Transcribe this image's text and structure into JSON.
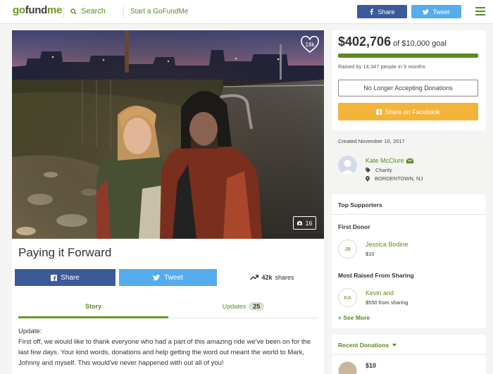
{
  "header": {
    "logo": {
      "part1": "go",
      "part2": "fund",
      "part3": "me"
    },
    "search_label": "Search",
    "start_label": "Start a GoFundMe",
    "share_label": "Share",
    "tweet_label": "Tweet"
  },
  "campaign": {
    "like_count": "18k",
    "photo_count": "16",
    "title": "Paying it Forward",
    "share_label": "Share",
    "tweet_label": "Tweet",
    "shares_count": "42k",
    "shares_suffix": "shares",
    "tabs": [
      {
        "label": "Story"
      },
      {
        "label": "Updates",
        "badge": "25"
      }
    ],
    "story": {
      "heading": "Update:",
      "body": "First off, we would like to thank everyone who had a part of this amazing ride we've been on for the last few days. Your kind words, donations and help getting the word out meant the world to Mark, Johnny and myself. This would've never happened with out all of you!"
    }
  },
  "donation": {
    "raised": "$402,706",
    "goal_text": "of $10,000 goal",
    "progress_fraction": 1.0,
    "raised_by": "Raised by 14,347 people in 9 months",
    "status_button": "No Longer Accepting Donations",
    "share_button": "Share on Facebook"
  },
  "organizer": {
    "created": "Created November 10, 2017",
    "name": "Kate McClure",
    "category": "Charity",
    "location": "BORDENTOWN, NJ"
  },
  "supporters": {
    "heading": "Top Supporters",
    "first_donor_heading": "First Donor",
    "first_donor": {
      "initials": "JB",
      "name": "Jessica Bodine",
      "amount": "$10"
    },
    "most_raised_heading": "Most Raised From Sharing",
    "top_sharer": {
      "initials": "KA",
      "name": "Kevin and",
      "amount": "$550 from sharing"
    },
    "see_more": "See More"
  },
  "recent": {
    "heading": "Recent Donations",
    "first_amount": "$10"
  },
  "colors": {
    "brand_green": "#5b8b1f",
    "facebook_blue": "#3b5a9a",
    "twitter_blue": "#55acee",
    "share_orange": "#f4b43c"
  }
}
